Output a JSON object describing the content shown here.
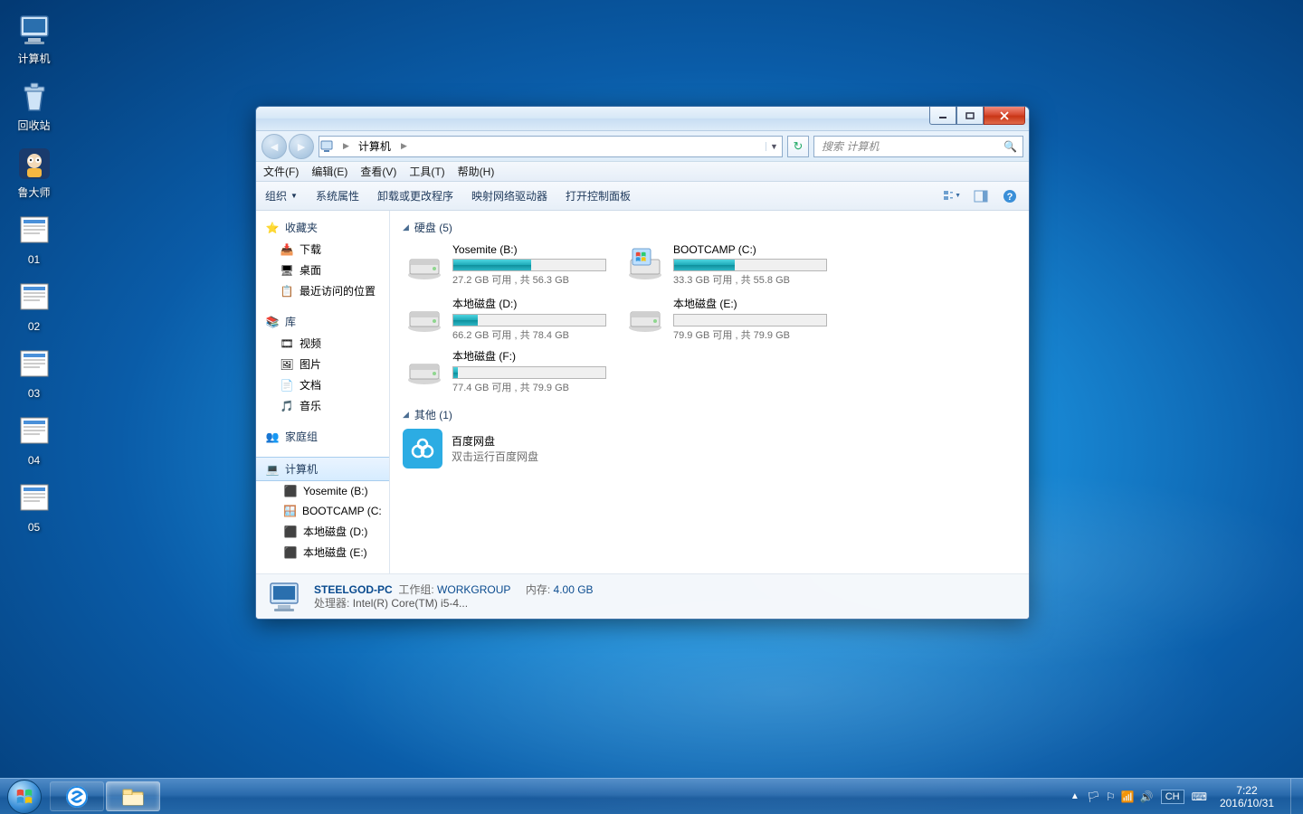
{
  "desktop": [
    {
      "label": "计算机",
      "kind": "computer"
    },
    {
      "label": "回收站",
      "kind": "recycle"
    },
    {
      "label": "鲁大师",
      "kind": "app-ludashi"
    },
    {
      "label": "01",
      "kind": "image"
    },
    {
      "label": "02",
      "kind": "image"
    },
    {
      "label": "03",
      "kind": "image"
    },
    {
      "label": "04",
      "kind": "image"
    },
    {
      "label": "05",
      "kind": "image"
    }
  ],
  "explorer": {
    "breadcrumb": [
      "计算机"
    ],
    "search_placeholder": "搜索 计算机",
    "menus": [
      "文件(F)",
      "编辑(E)",
      "查看(V)",
      "工具(T)",
      "帮助(H)"
    ],
    "toolbar": {
      "organize": "组织",
      "items": [
        "系统属性",
        "卸载或更改程序",
        "映射网络驱动器",
        "打开控制面板"
      ]
    },
    "nav": {
      "favorites": {
        "label": "收藏夹",
        "items": [
          "下载",
          "桌面",
          "最近访问的位置"
        ]
      },
      "libraries": {
        "label": "库",
        "items": [
          "视频",
          "图片",
          "文档",
          "音乐"
        ]
      },
      "homegroup": "家庭组",
      "computer": {
        "label": "计算机",
        "items": [
          "Yosemite (B:)",
          "BOOTCAMP (C:",
          "本地磁盘 (D:)",
          "本地磁盘 (E:)"
        ]
      }
    },
    "groups": {
      "hdd": {
        "title": "硬盘 (5)",
        "drives": [
          {
            "name": "Yosemite (B:)",
            "caption": "27.2 GB 可用 , 共 56.3 GB",
            "kind": "hdd",
            "fill": 51
          },
          {
            "name": "BOOTCAMP (C:)",
            "caption": "33.3 GB 可用 , 共 55.8 GB",
            "kind": "win",
            "fill": 40
          },
          {
            "name": "本地磁盘 (D:)",
            "caption": "66.2 GB 可用 , 共 78.4 GB",
            "kind": "hdd",
            "fill": 16
          },
          {
            "name": "本地磁盘 (E:)",
            "caption": "79.9 GB 可用 , 共 79.9 GB",
            "kind": "hdd",
            "fill": 0
          },
          {
            "name": "本地磁盘 (F:)",
            "caption": "77.4 GB 可用 , 共 79.9 GB",
            "kind": "hdd",
            "fill": 3
          }
        ]
      },
      "other": {
        "title": "其他 (1)",
        "items": [
          {
            "name": "百度网盘",
            "sub": "双击运行百度网盘"
          }
        ]
      }
    },
    "details": {
      "name": "STEELGOD-PC",
      "workgroup_label": "工作组:",
      "workgroup": "WORKGROUP",
      "mem_label": "内存:",
      "mem": "4.00 GB",
      "cpu_label": "处理器:",
      "cpu": "Intel(R) Core(TM) i5-4..."
    }
  },
  "tray": {
    "lang": "CH",
    "time": "7:22",
    "date": "2016/10/31"
  }
}
